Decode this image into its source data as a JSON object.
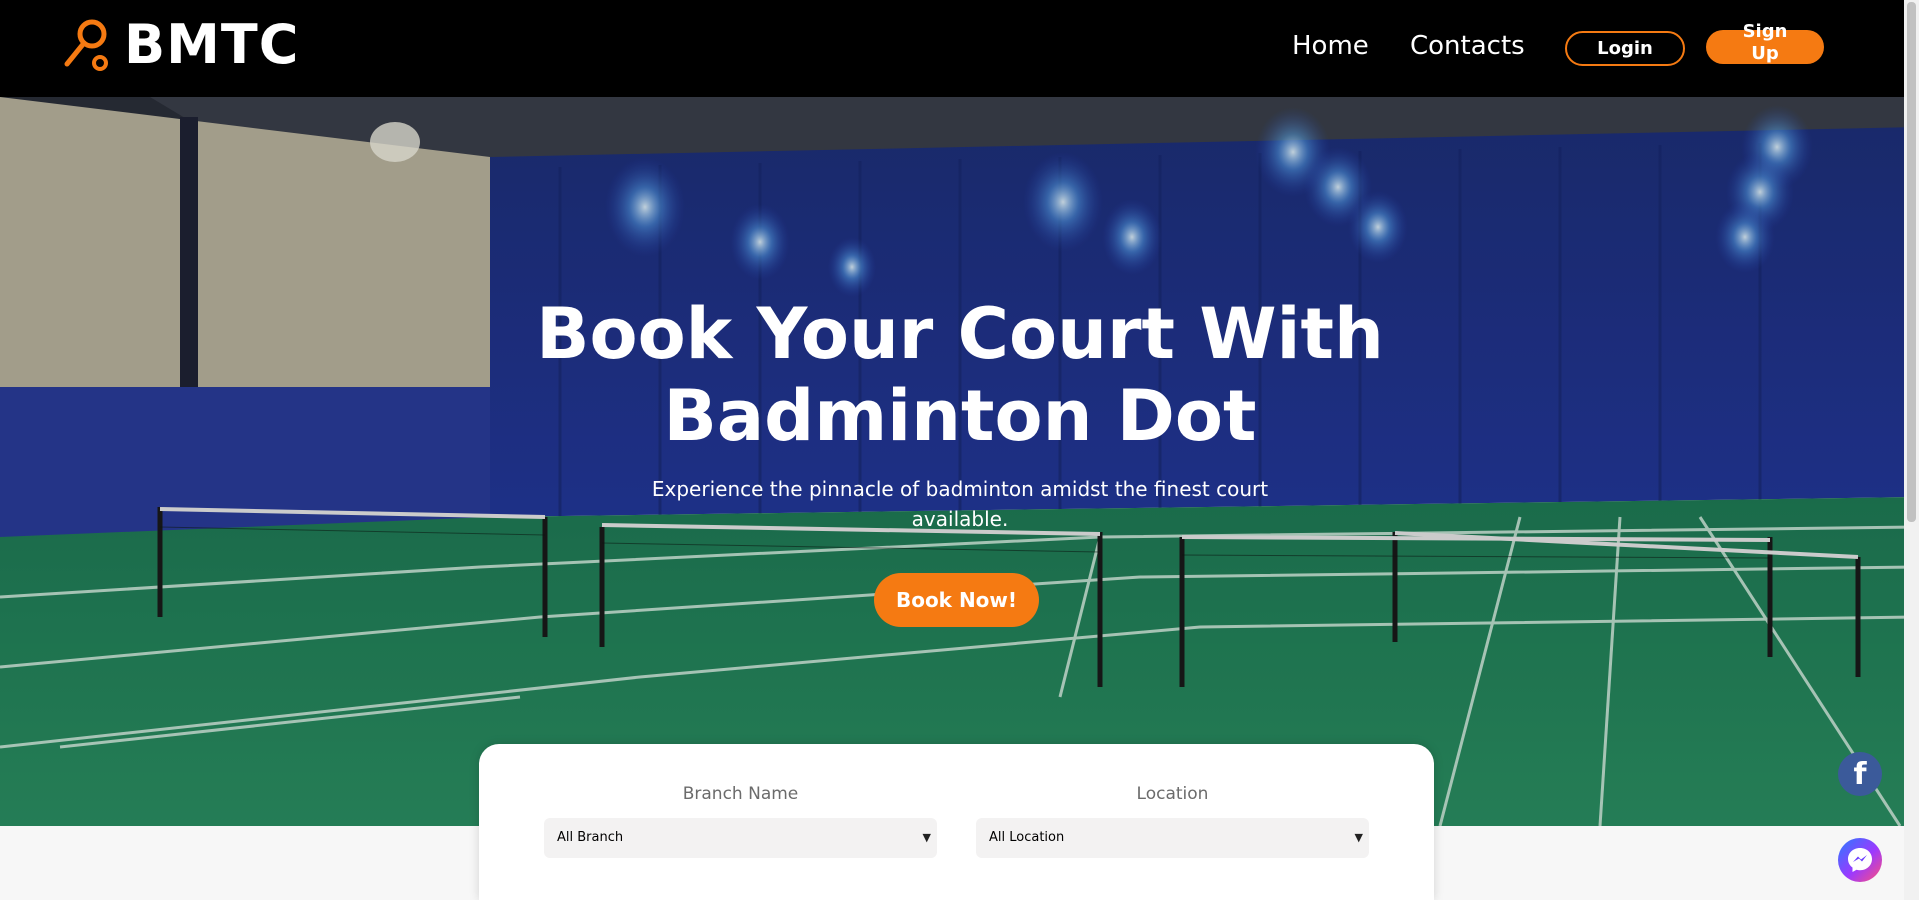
{
  "header": {
    "brand": "BMTC",
    "nav": {
      "home": "Home",
      "contacts": "Contacts"
    },
    "login": "Login",
    "signup": "Sign Up"
  },
  "hero": {
    "title": "Book Your Court With Badminton Dot",
    "subtitle": "Experience the pinnacle of badminton amidst the finest court available.",
    "cta": "Book Now!"
  },
  "search": {
    "branch_label": "Branch Name",
    "branch_value": "All Branch",
    "location_label": "Location",
    "location_value": "All Location"
  },
  "social": {
    "facebook_glyph": "f"
  },
  "colors": {
    "accent": "#f57a12",
    "header_bg": "#000000",
    "facebook": "#3b5a9a"
  },
  "icons": [
    "racket-logo-icon",
    "chevron-down-icon",
    "facebook-icon",
    "messenger-icon"
  ]
}
